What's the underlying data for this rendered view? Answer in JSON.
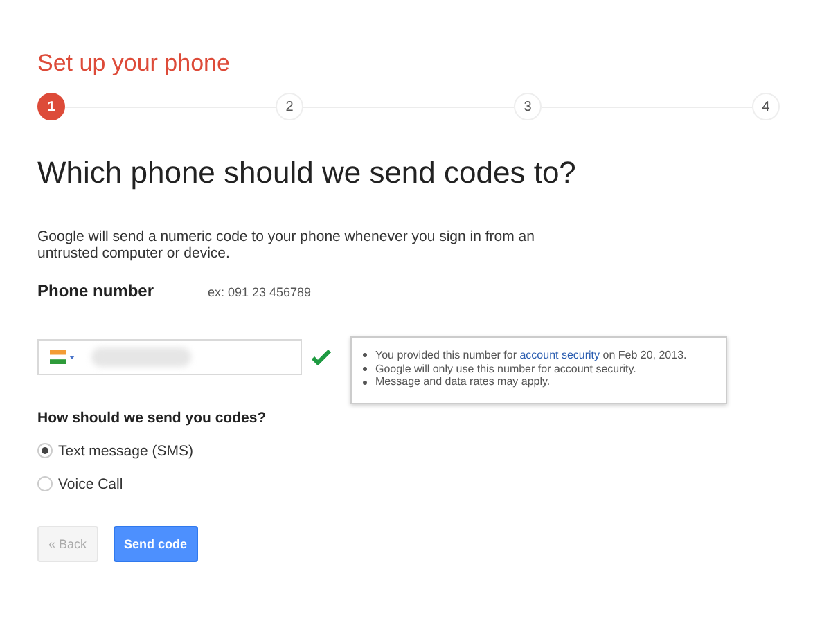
{
  "title": "Set up your phone",
  "steps": [
    {
      "label": "1",
      "selected": true
    },
    {
      "label": "2",
      "selected": false
    },
    {
      "label": "3",
      "selected": false
    },
    {
      "label": "4",
      "selected": false
    }
  ],
  "heading": "Which phone should we send codes to?",
  "description": "Google will send a numeric code to your phone whenever you sign in from an untrusted computer or device.",
  "phone": {
    "label": "Phone number",
    "example": "ex: 091 23 456789",
    "verified": true
  },
  "tooltip": [
    {
      "before": "You provided this number for ",
      "link": "account security",
      "after": " on Feb 20, 2013."
    },
    {
      "before": "Google will only use this number for account security."
    },
    {
      "before": "Message and data rates may apply."
    }
  ],
  "method": {
    "question": "How should we send you codes?",
    "options": [
      {
        "label": "Text message (SMS)",
        "selected": true
      },
      {
        "label": "Voice Call",
        "selected": false
      }
    ]
  },
  "buttons": [
    {
      "label": "« Back",
      "disabled": true
    },
    {
      "label": "Send code",
      "disabled": false
    }
  ]
}
